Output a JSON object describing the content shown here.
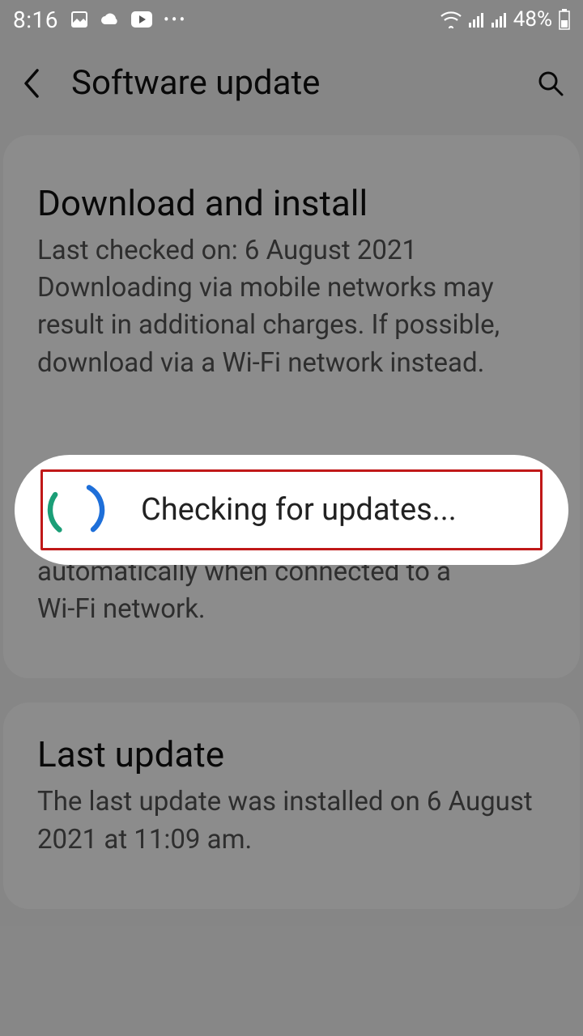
{
  "status_bar": {
    "time": "8:16",
    "battery_percent": "48%"
  },
  "header": {
    "title": "Software update"
  },
  "card1": {
    "download_install": {
      "title": "Download and install",
      "desc": "Last checked on: 6 August 2021\nDownloading via mobile networks may result in additional charges. If possible, download via a Wi-Fi network instead."
    },
    "auto_download": {
      "desc": "Download software updates automatically when connected to a Wi-Fi network."
    }
  },
  "card2": {
    "last_update": {
      "title": "Last update",
      "desc": "The last update was installed on 6 August 2021 at 11:09 am."
    }
  },
  "dialog": {
    "message": "Checking for updates..."
  }
}
